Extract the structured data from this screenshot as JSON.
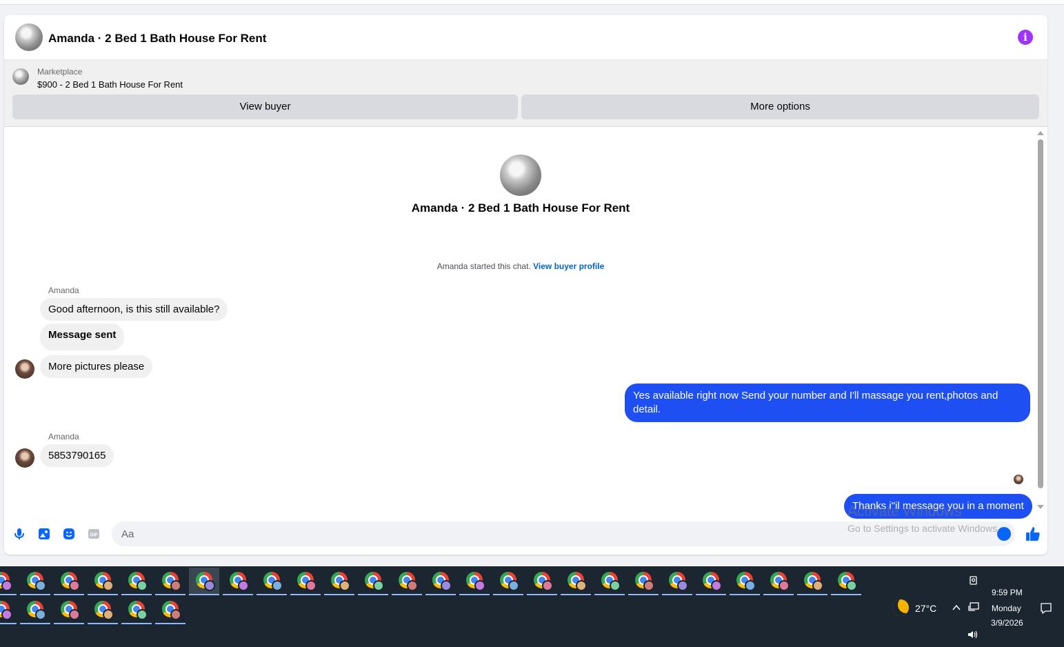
{
  "chat": {
    "title": "Amanda · 2 Bed 1 Bath House For Rent",
    "info_icon": "info-icon",
    "marketplace": {
      "label": "Marketplace",
      "item": "$900 - 2 Bed 1 Bath House For Rent",
      "view_buyer": "View buyer",
      "more_options": "More options"
    },
    "intro": {
      "title": "Amanda · 2 Bed 1 Bath House For Rent",
      "started_text": "Amanda started this chat.",
      "view_profile": "View buyer profile"
    },
    "messages": [
      {
        "from": "Amanda",
        "sender_label": "Amanda",
        "text": "Good afternoon, is this still available?"
      },
      {
        "from": "Amanda",
        "text": "Message sent"
      },
      {
        "from": "Amanda",
        "text": "More pictures please"
      },
      {
        "from": "me",
        "text": "Yes available right now Send your number and I'll massage you rent,photos and detail."
      },
      {
        "from": "Amanda",
        "sender_label": "Amanda",
        "text": "5853790165"
      },
      {
        "from": "me",
        "text": "Thanks i\"il message you in a moment"
      }
    ],
    "composer": {
      "placeholder": "Aa",
      "icons": [
        "microphone-icon",
        "photo-icon",
        "sticker-icon",
        "gif-icon",
        "emoji-icon",
        "like-icon"
      ]
    },
    "colors": {
      "outgoing": "#1e4ff2",
      "incoming": "#f0f0f0",
      "accent": "#a033ff",
      "link": "#0064d1"
    }
  },
  "watermark": {
    "line1": "Activate Windows",
    "line2": "Go to Settings to activate Windows."
  },
  "taskbar": {
    "weather_temp": "27°C",
    "time": "9:59 PM",
    "day": "Monday",
    "date": "3/9/2026",
    "row1_count": 26,
    "row2_count": 6
  }
}
